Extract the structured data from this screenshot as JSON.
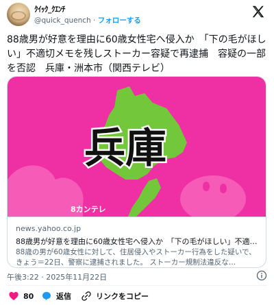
{
  "header": {
    "display_name": "ｸｲｯｸ_ｸｴﾝﾁ",
    "handle": "@quick_quench",
    "separator": "·",
    "follow_label": "フォローする"
  },
  "tweet": {
    "text": "88歳男が好意を理由に60歳女性宅へ侵入か　「下の毛がほしい」不適切メモを残しストーカー容疑で再逮捕　容疑の一部を否認　兵庫・洲本市（関西テレビ）",
    "timestamp": "午後3:22 · 2025年11月22日"
  },
  "card": {
    "image_caption": "兵庫",
    "image_logo": "8カンテレ",
    "domain": "news.yahoo.co.jp",
    "title": "88歳男が好意を理由に60歳女性宅へ侵入か　「下の毛がほしい」不適切…",
    "description": "88歳の男が60歳女性に対して、住居侵入やストーカー行為をした疑いで、きょう＝22日、警察に逮捕されました。 ストーカー規制法違反な…"
  },
  "actions": {
    "like_count": "80",
    "reply_label": "返信",
    "copy_link_label": "リンクをコピー"
  },
  "colors": {
    "card_background": "#ef2fa4",
    "map_fill": "#72c83a",
    "like_red": "#f91880",
    "link_blue": "#1d9bf0"
  }
}
